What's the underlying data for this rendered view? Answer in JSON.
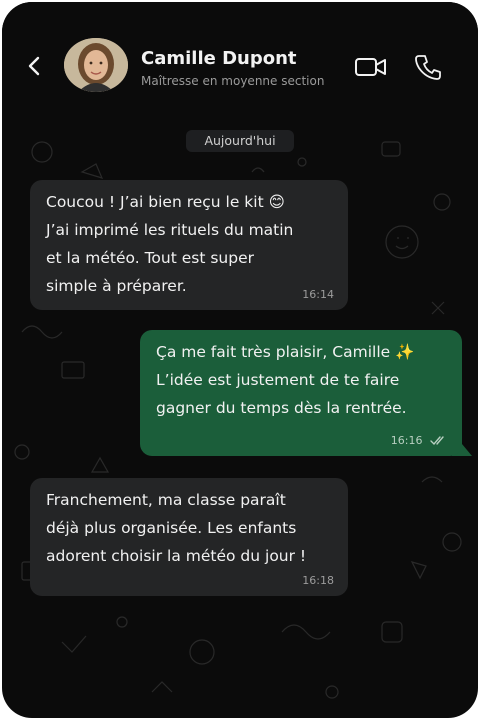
{
  "contact": {
    "name": "Camille Dupont",
    "status": "Maîtresse en moyenne section"
  },
  "date_chip": "Aujourd'hui",
  "messages": [
    {
      "direction": "incoming",
      "text": "Coucou ! J’ai bien reçu le kit 😊\nJ’ai imprimé les rituels du matin\net la météo. Tout est super\nsimple à préparer.",
      "time": "16:14"
    },
    {
      "direction": "outgoing",
      "text": "Ça me fait très plaisir, Camille ✨\nL’idée est justement de te faire\ngagner du temps dès la rentrée.",
      "time": "16:16",
      "read_receipt": "double-check-icon"
    },
    {
      "direction": "incoming",
      "text": "Franchement, ma classe paraît\ndéjà plus organisée. Les enfants\nadorent choisir la météo du jour !",
      "time": "16:18"
    }
  ],
  "icons": {
    "back": "chevron-left-icon",
    "video": "video-camera-icon",
    "call": "phone-icon"
  },
  "colors": {
    "background": "#0b0b0b",
    "incoming_bubble": "#242526",
    "outgoing_bubble": "#1b5e3a",
    "text": "#f1f1f1",
    "muted": "#9a9a9a"
  }
}
